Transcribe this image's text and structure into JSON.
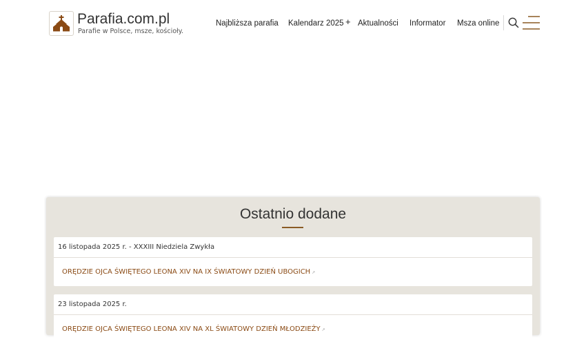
{
  "site": {
    "title": "Parafia.com.pl",
    "tagline": "Parafie w Polsce, msze, kościoły."
  },
  "nav": {
    "items": [
      "Najbliższa parafia",
      "Kalendarz 2025",
      "Aktualności",
      "Informator",
      "Msza online"
    ],
    "plus": "+"
  },
  "icons": {
    "logo": "church-icon",
    "search": "search-icon",
    "menu": "hamburger-menu-icon",
    "external": "external-link-icon"
  },
  "colors": {
    "accent": "#8a5a24",
    "link": "#8a4a14",
    "panel_bg": "#e7e4dd"
  },
  "recent": {
    "heading": "Ostatnio dodane",
    "entries": [
      {
        "date": "16 listopada 2025 r. - XXXIII Niedziela Zwykła",
        "link": "ORĘDZIE OJCA ŚWIĘTEGO LEONA XIV NA IX ŚWIATOWY DZIEŃ UBOGICH",
        "ext": "↗"
      },
      {
        "date": "23 listopada 2025 r.",
        "link": "ORĘDZIE OJCA ŚWIĘTEGO LEONA XIV NA XL ŚWIATOWY DZIEŃ MŁODZIEŻY",
        "ext": "↗"
      }
    ]
  }
}
